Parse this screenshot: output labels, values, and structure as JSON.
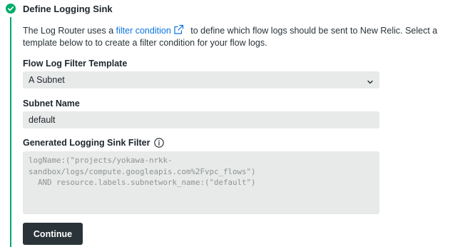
{
  "step": {
    "title": "Define Logging Sink",
    "status_icon": "check-circle-icon",
    "accent_color": "#00ac69"
  },
  "description": {
    "before_link": "The Log Router uses a ",
    "link_text": "filter condition",
    "after_link": " to define which flow logs should be sent to New Relic. Select a template below to to create a filter condition for your flow logs."
  },
  "filter_template": {
    "label": "Flow Log Filter Template",
    "selected": "A Subnet"
  },
  "subnet_name": {
    "label": "Subnet Name",
    "value": "default"
  },
  "generated_filter": {
    "label": "Generated Logging Sink Filter",
    "code": "logName:(\"projects/yokawa-nrkk-\nsandbox/logs/compute.googleapis.com%2Fvpc_flows\")\n  AND resource.labels.subnetwork_name:(\"default\")"
  },
  "actions": {
    "continue_label": "Continue"
  }
}
